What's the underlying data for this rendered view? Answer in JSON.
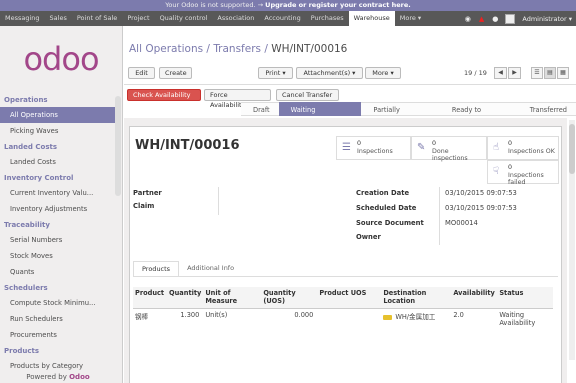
{
  "warning": {
    "text": "Your Odoo is not supported.",
    "link": "Upgrade or register your contract here."
  },
  "topnav": {
    "items": [
      "Messaging",
      "Sales",
      "Point of Sale",
      "Project",
      "Quality control",
      "Association",
      "Accounting",
      "Purchases",
      "Warehouse",
      "More ▾"
    ],
    "active": "Warehouse",
    "user": "Administrator ▾"
  },
  "sidebar": {
    "logo": "odoo",
    "sections": [
      {
        "title": "Operations",
        "items": [
          "All Operations",
          "Picking Waves"
        ]
      },
      {
        "title": "Landed Costs",
        "items": [
          "Landed Costs"
        ]
      },
      {
        "title": "Inventory Control",
        "items": [
          "Current Inventory Valu...",
          "Inventory Adjustments"
        ]
      },
      {
        "title": "Traceability",
        "items": [
          "Serial Numbers",
          "Stock Moves",
          "Quants"
        ]
      },
      {
        "title": "Schedulers",
        "items": [
          "Compute Stock Minimu...",
          "Run Schedulers",
          "Procurements"
        ]
      },
      {
        "title": "Products",
        "items": [
          "Products by Category"
        ]
      }
    ],
    "active_item": "All Operations",
    "powered_by": "Powered by",
    "powered_brand": "Odoo"
  },
  "breadcrumb": {
    "part1": "All Operations",
    "sep1": " / ",
    "part2": "Transfers",
    "sep2": " / ",
    "current": "WH/INT/00016"
  },
  "toolbar": {
    "edit": "Edit",
    "create": "Create",
    "print": "Print ▾",
    "attachments": "Attachment(s) ▾",
    "more": "More ▾",
    "pager": "19 / 19"
  },
  "actions": {
    "check_availability": "Check Availability",
    "force_availability": "Force Availability",
    "cancel_transfer": "Cancel Transfer"
  },
  "stages": [
    "Draft",
    "Waiting Availability",
    "Partially Available",
    "Ready to Transfer",
    "Transferred"
  ],
  "active_stage": "Waiting Availability",
  "record": {
    "name": "WH/INT/00016",
    "smart_buttons": [
      {
        "count": "0",
        "label": "Inspections",
        "icon": "list-icon"
      },
      {
        "count": "0",
        "label": "Done inspections",
        "icon": "pencil-icon"
      },
      {
        "count": "0",
        "label": "Inspections OK",
        "icon": "thumbs-up-icon"
      },
      {
        "count": "0",
        "label": "Inspections failed",
        "icon": "thumbs-down-icon"
      }
    ],
    "left_fields": [
      {
        "label": "Partner",
        "value": ""
      },
      {
        "label": "Claim",
        "value": ""
      }
    ],
    "right_fields": [
      {
        "label": "Creation Date",
        "value": "03/10/2015 09:07:53"
      },
      {
        "label": "Scheduled Date",
        "value": "03/10/2015 09:07:53"
      },
      {
        "label": "Source Document",
        "value": "MO00014"
      },
      {
        "label": "Owner",
        "value": ""
      }
    ]
  },
  "tabs": [
    "Products",
    "Additional Info"
  ],
  "lines_table": {
    "headers": [
      "Product",
      "Quantity",
      "Unit of Measure",
      "Quantity (UOS)",
      "Product UOS",
      "Destination Location",
      "Availability",
      "Status"
    ],
    "rows": [
      [
        "钢棒",
        "1.300",
        "Unit(s)",
        "0.000",
        "",
        "WH/金属加工",
        "2.0",
        "Waiting Availability"
      ]
    ]
  }
}
